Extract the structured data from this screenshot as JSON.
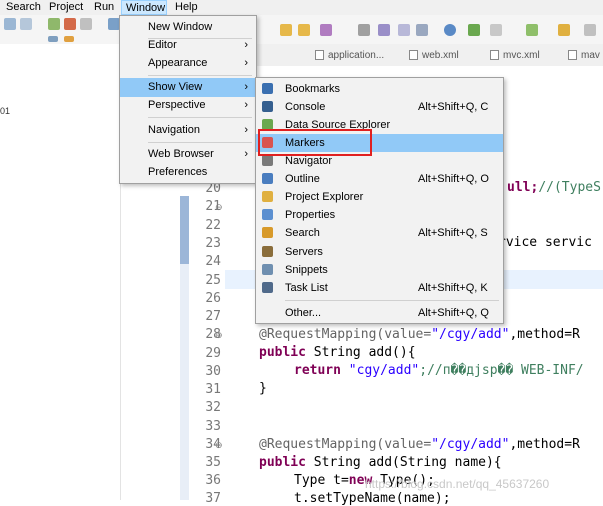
{
  "menubar": {
    "items": [
      "Search",
      "Project",
      "Run",
      "Window",
      "Help"
    ]
  },
  "tabs": [
    "application...",
    "web.xml",
    "mvc.xml",
    "mav"
  ],
  "left_panel": {
    "fragment": "01"
  },
  "window_menu": {
    "items": [
      "New Window",
      "Editor",
      "Appearance",
      "Show View",
      "Perspective",
      "Navigation",
      "Web Browser",
      "Preferences"
    ],
    "arrow": "›"
  },
  "show_view_menu": {
    "items": [
      {
        "label": "Bookmarks",
        "shortcut": "",
        "icon": "bookmarks-icon",
        "color": "#3a6fb0"
      },
      {
        "label": "Console",
        "shortcut": "Alt+Shift+Q, C",
        "icon": "console-icon",
        "color": "#355f8f"
      },
      {
        "label": "Data Source Explorer",
        "shortcut": "",
        "icon": "database-icon",
        "color": "#6aa84f"
      },
      {
        "label": "Markers",
        "shortcut": "",
        "icon": "markers-icon",
        "color": "#d9534f"
      },
      {
        "label": "Navigator",
        "shortcut": "",
        "icon": "navigator-icon",
        "color": "#7a7a7a"
      },
      {
        "label": "Outline",
        "shortcut": "Alt+Shift+Q, O",
        "icon": "outline-icon",
        "color": "#4a7dbf"
      },
      {
        "label": "Project Explorer",
        "shortcut": "",
        "icon": "folder-icon",
        "color": "#e0b040"
      },
      {
        "label": "Properties",
        "shortcut": "",
        "icon": "properties-icon",
        "color": "#5b8fd0"
      },
      {
        "label": "Search",
        "shortcut": "Alt+Shift+Q, S",
        "icon": "search-icon",
        "color": "#d89a2a"
      },
      {
        "label": "Servers",
        "shortcut": "",
        "icon": "servers-icon",
        "color": "#8a6d3b"
      },
      {
        "label": "Snippets",
        "shortcut": "",
        "icon": "snippets-icon",
        "color": "#6f8fb0"
      },
      {
        "label": "Task List",
        "shortcut": "Alt+Shift+Q, K",
        "icon": "tasklist-icon",
        "color": "#506a8a"
      },
      {
        "label": "Other...",
        "shortcut": "Alt+Shift+Q, Q",
        "icon": "",
        "color": ""
      }
    ]
  },
  "editor": {
    "line_numbers": [
      "20",
      "21",
      "22",
      "23",
      "24",
      "25",
      "26",
      "27",
      "28",
      "29",
      "30",
      "31",
      "32",
      "33",
      "34",
      "35",
      "36",
      "37"
    ],
    "code": {
      "l20_a": "ull;",
      "l20_b": "//(TypeS",
      "l23": "rvice servic",
      "l28_ann": "@RequestMapping(value=",
      "l28_str": "\"/cgy/add\"",
      "l28_rest": ",method=R",
      "l29_kw": "public",
      "l29_rest": " String add(){",
      "l30_kw": "return",
      "l30_str": " \"cgy/add\"",
      "l30_cmt": ";//п��дjsp�� WEB-INF/",
      "l31": "}",
      "l34_ann": "@RequestMapping(value=",
      "l34_str": "\"/cgy/add\"",
      "l34_rest": ",method=R",
      "l35_kw": "public",
      "l35_rest": " String add(String name){",
      "l36_a": "Type t=",
      "l36_kw": "new",
      "l36_b": " Type();",
      "l37": "t.setTypeName(name);"
    }
  },
  "watermark": "https://blog.csdn.net/qq_45637260"
}
